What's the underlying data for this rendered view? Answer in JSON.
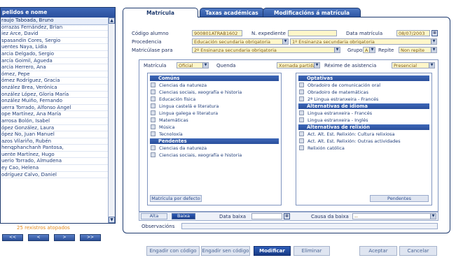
{
  "list": {
    "header": "pelidos e nome",
    "items": [
      "raujo Taboada, Bruno",
      "orrazás Fernández, Brian",
      "iez Arce, David",
      "spasandin Cores, Sergio",
      "uentes Naya, Lidia",
      "arcia Delgado, Sergio",
      "arcía Goimil, Águeda",
      "arcia Herrero, Ana",
      "ómez, Pepe",
      "ómez Rodríguez, Gracia",
      "onzález Brea, Verónica",
      "onzález López, Gloria María",
      "onzález Muiño, Fernando",
      "uerra Torrado, Alfonso Ángel",
      "ope Martínez, Ana María",
      "arrosa Bolón, Isabel",
      "ópez González, Laura",
      "ópez No, Juan Manuel",
      "azos Vilariño, Rubén",
      "henqphanchanh Pantosa,",
      "uente Martínez, Hugo",
      "uerio Torrado, Almudena",
      "ey Cao, Helena",
      "odríguez Calvo, Daniel"
    ],
    "records_label": "25 rexistros atopados",
    "nav": [
      "<<",
      "<",
      ">",
      ">>"
    ]
  },
  "tabs": [
    "Matrícula",
    "Taxas académicas",
    "Modificacións á matrícula"
  ],
  "form": {
    "codigo_label": "Código alumno",
    "codigo_value": "900801ATRAB1602",
    "expediente_label": "N. expediente",
    "expediente_value": "",
    "data_matricula_label": "Data matrícula",
    "data_matricula_value": "08/07/2003",
    "procedencia_label": "Procedencia",
    "procedencia_value1": "Educación secundaria obrigatoria",
    "procedencia_value2": "1º Ensinanza secundaria obrigatoria",
    "matriculase_label": "Matricúlase para",
    "matriculase_value": "2º Ensinanza secundaria obrigatoria",
    "grupo_label": "Grupo",
    "grupo_value": "A",
    "repite_label": "Repite",
    "repite_value": "Non repite",
    "matricula_label": "Matrícula",
    "matricula_value": "Oficial",
    "quenda_label": "Quenda",
    "quenda_value": "Xornada partida",
    "rexime_label": "Réxime de asistencia",
    "rexime_value": "Presencial"
  },
  "subjects_left": {
    "comuns_header": "Comúns",
    "comuns": [
      "Ciencias da natureza",
      "Ciencias sociais, xeografía e historia",
      "Educación física",
      "Lingua castelá e literatura",
      "Lingua galega e literatura",
      "Matemáticas",
      "Música",
      "Tecnoloxía"
    ],
    "pendentes_header": "Pendentes",
    "pendentes": [
      "Ciencias da natureza",
      "Ciencias sociais, xeografía e historia"
    ],
    "default_button": "Matrícula por defecto"
  },
  "subjects_right": {
    "optativas_header": "Optativas",
    "optativas": [
      "Obradoiro de comunicación oral",
      "Obradoiro de matemáticas",
      "2ª Lingua estranxeira - Francés"
    ],
    "idioma_header": "Alternativas de idioma",
    "idioma": [
      "Lingua estranxeira - Francés",
      "Lingua estranxeira - Inglés"
    ],
    "relixion_header": "Alternativas de relixión",
    "relixion": [
      "Act. Alt. Est. Relixión: Cultura relixiosa",
      "Act. Alt. Est. Relixión: Outras actividades",
      "Relixión católica"
    ],
    "pendentes_button": "Pendentes"
  },
  "status": {
    "alta": "Alta",
    "baixa": "Baixa",
    "data_baixa_label": "Data baixa",
    "causa_label": "Causa da baixa",
    "causa_value": "--",
    "observacions_label": "Observacións"
  },
  "actions": [
    "Engadir con código",
    "Engadir sen código",
    "Modificar",
    "Eliminar",
    "Aceptar",
    "Cancelar"
  ],
  "colors": {
    "accent": "#2a4f9c",
    "field_bg": "#fff6c9",
    "records_text": "#e48a1c"
  }
}
